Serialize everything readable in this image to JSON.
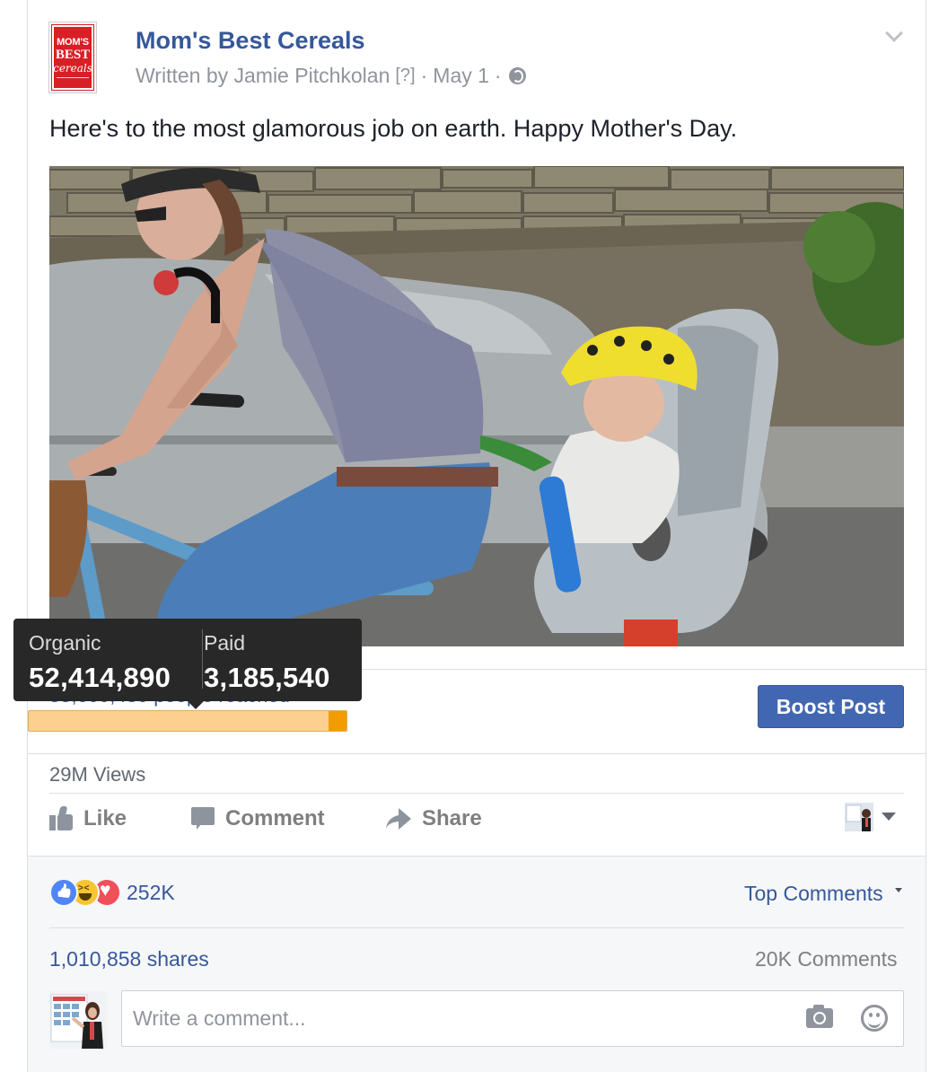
{
  "post": {
    "page_name": "Mom's Best Cereals",
    "logo": {
      "line1": "MOM'S",
      "line2": "BEST",
      "line3": "cereals"
    },
    "written_by": "Written by Jamie Pitchkolan",
    "help_marker": "[?]",
    "separator": "·",
    "date": "May 1",
    "audience_icon": "globe-icon",
    "options_icon": "chevron-down-icon",
    "message": "Here's to the most glamorous job on earth. Happy Mother's Day."
  },
  "reach": {
    "tooltip": {
      "organic_label": "Organic",
      "organic_value": "52,414,890",
      "paid_label": "Paid",
      "paid_value": "3,185,540"
    },
    "people_reached_partial": "55,600,430 people reached",
    "paid_fraction": 0.057,
    "colors": {
      "organic": "#fdd08f",
      "paid": "#f39c00"
    }
  },
  "boost": {
    "label": "Boost Post",
    "color": "#4267b2"
  },
  "views": "29M Views",
  "actions": {
    "like": "Like",
    "comment": "Comment",
    "share": "Share"
  },
  "reactions": {
    "icons": [
      "like-reaction-icon",
      "haha-reaction-icon",
      "love-reaction-icon"
    ],
    "count": "252K"
  },
  "top_comments": "Top Comments",
  "shares": "1,010,858 shares",
  "comments_count": "20K Comments",
  "comment_input": {
    "placeholder": "Write a comment..."
  },
  "brand_color": "#365899"
}
